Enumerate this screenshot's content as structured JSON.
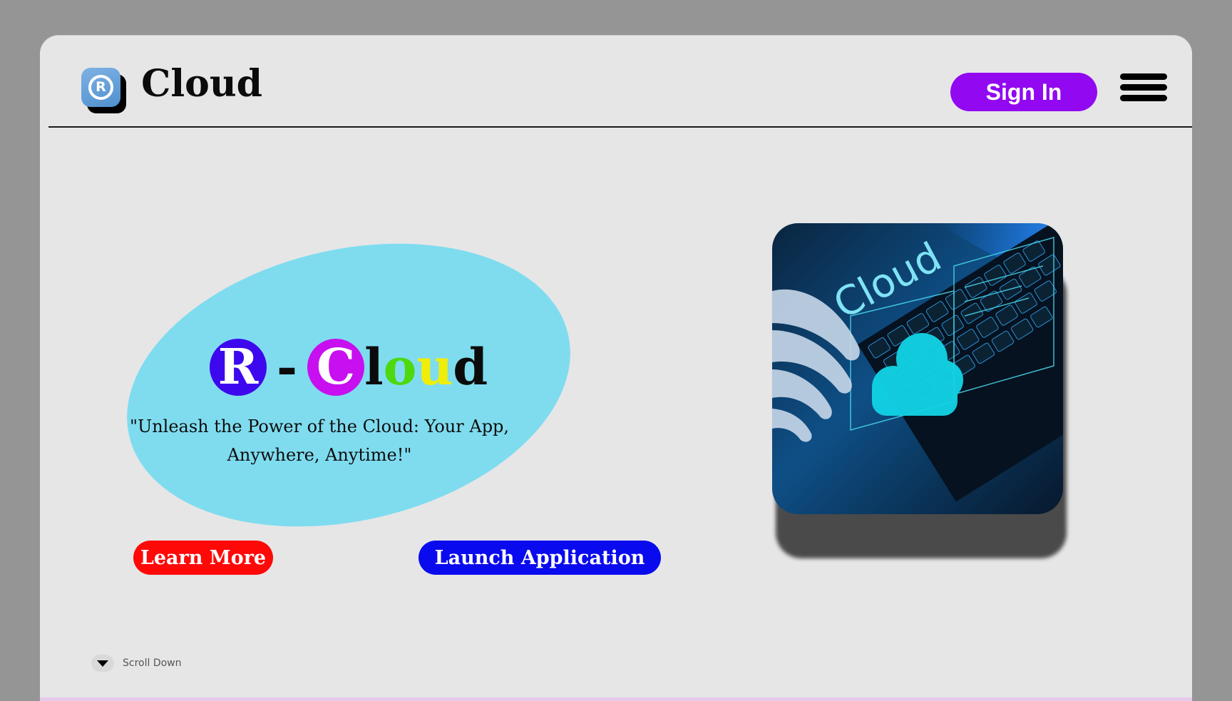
{
  "header": {
    "brand_name": "Cloud",
    "logo_letter": "R",
    "signin_label": "Sign In"
  },
  "hero": {
    "title_letters": [
      "R",
      "-",
      "C",
      "l",
      "o",
      "u",
      "d"
    ],
    "tagline": "\"Unleash the Power of the Cloud: Your App, Anywhere, Anytime!\"",
    "learn_more_label": "Learn More",
    "launch_label": "Launch Application",
    "image_text": "Cloud"
  },
  "footer": {
    "scroll_label": "Scroll Down"
  },
  "colors": {
    "page_bg": "#959595",
    "frame_bg": "#e6e6e7",
    "signin": "#9208f0",
    "ellipse": "#7fdcef",
    "circle_r": "#3d08ee",
    "circle_c": "#c70fef",
    "letter_o": "#4dd90e",
    "letter_u": "#f0ee08",
    "learn_more": "#ff0808",
    "launch": "#0a0aee"
  },
  "icons": {
    "logo": "registered-icon",
    "menu": "hamburger-menu-icon",
    "scroll": "chevron-down-icon"
  }
}
